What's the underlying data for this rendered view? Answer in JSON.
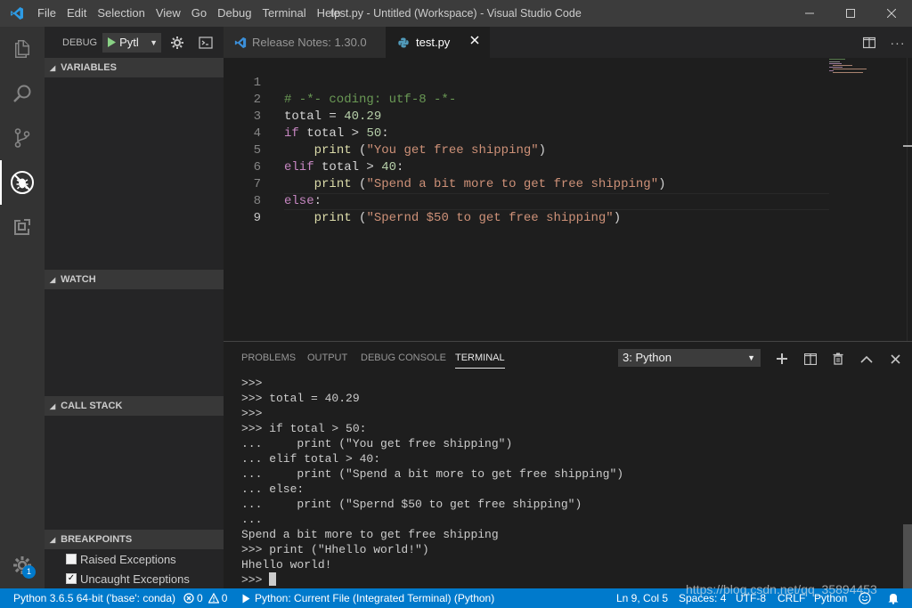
{
  "window": {
    "title": "test.py - Untitled (Workspace) - Visual Studio Code"
  },
  "menu": [
    "File",
    "Edit",
    "Selection",
    "View",
    "Go",
    "Debug",
    "Terminal",
    "Help"
  ],
  "sidebar": {
    "title": "DEBUG",
    "config_name": "Pytl",
    "sections": {
      "variables": "VARIABLES",
      "watch": "WATCH",
      "call_stack": "CALL STACK",
      "breakpoints": "BREAKPOINTS"
    },
    "breakpoints": [
      {
        "label": "Raised Exceptions",
        "checked": false
      },
      {
        "label": "Uncaught Exceptions",
        "checked": true
      }
    ]
  },
  "activity_bar": {
    "items": [
      "explorer-icon",
      "search-icon",
      "source-control-icon",
      "debug-icon",
      "extensions-icon"
    ],
    "settings_badge": "1"
  },
  "tabs": [
    {
      "label": "Release Notes: 1.30.0",
      "active": false
    },
    {
      "label": "test.py",
      "active": true
    }
  ],
  "editor": {
    "line_numbers": [
      "1",
      "2",
      "3",
      "4",
      "5",
      "6",
      "7",
      "8",
      "9"
    ]
  },
  "panel": {
    "tabs": [
      "PROBLEMS",
      "OUTPUT",
      "DEBUG CONSOLE",
      "TERMINAL"
    ],
    "active_tab": "TERMINAL",
    "terminal_selector": "3: Python",
    "terminal_lines": [
      ">>>",
      ">>> total = 40.29",
      ">>>",
      ">>> if total > 50:",
      "...     print (\"You get free shipping\")",
      "... elif total > 40:",
      "...     print (\"Spend a bit more to get free shipping\")",
      "... else:",
      "...     print (\"Spernd $50 to get free shipping\")",
      "...",
      "Spend a bit more to get free shipping",
      ">>> print (\"Hhello world!\")",
      "Hhello world!",
      ">>> "
    ]
  },
  "statusbar": {
    "interpreter": "Python 3.6.5 64-bit ('base': conda)",
    "errors": "0",
    "warnings": "0",
    "debug_config": "Python: Current File (Integrated Terminal) (Python)",
    "position": "Ln 9, Col 5",
    "spaces": "Spaces: 4",
    "encoding": "UTF-8",
    "eol": "CRLF",
    "language": "Python"
  },
  "watermark": "https://blog.csdn.net/qq_35894453",
  "colors": {
    "accent": "#007acc",
    "titlebar": "#3c3c3c",
    "sidebar": "#252526",
    "editor_bg": "#1e1e1e"
  }
}
